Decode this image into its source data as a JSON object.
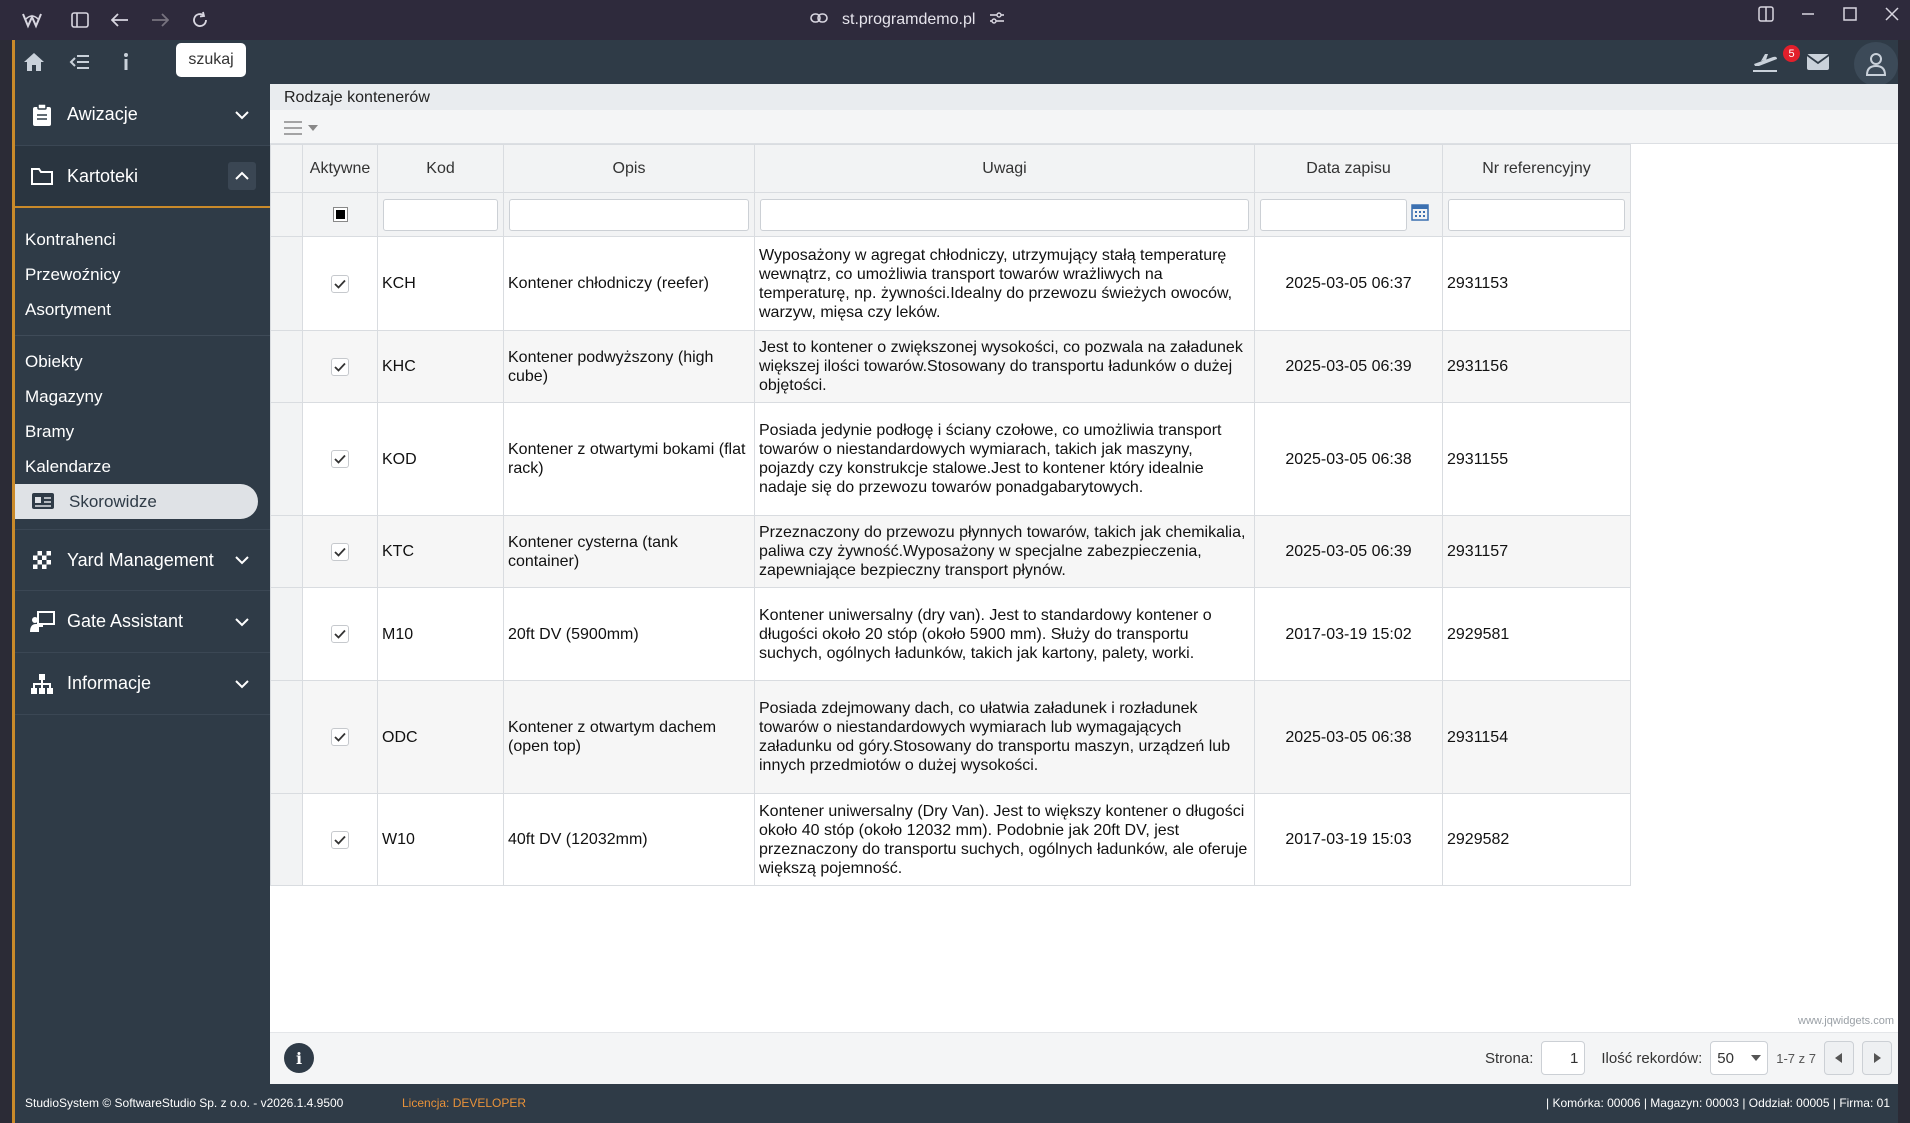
{
  "browser": {
    "url": "st.programdemo.pl"
  },
  "toolbar": {
    "search_label": "szukaj",
    "mail_count": "5"
  },
  "sidebar": {
    "sections": [
      {
        "label": "Awizacje"
      },
      {
        "label": "Kartoteki"
      },
      {
        "label": "Yard Management"
      },
      {
        "label": "Gate Assistant"
      },
      {
        "label": "Informacje"
      }
    ],
    "group1": [
      "Kontrahenci",
      "Przewoźnicy",
      "Asortyment"
    ],
    "group2": [
      "Obiekty",
      "Magazyny",
      "Bramy",
      "Kalendarze",
      "Skorowidze"
    ]
  },
  "panel": {
    "title": "Rodzaje kontenerów"
  },
  "grid": {
    "columns": [
      "Aktywne",
      "Kod",
      "Opis",
      "Uwagi",
      "Data zapisu",
      "Nr referencyjny"
    ],
    "rows": [
      {
        "code": "KCH",
        "desc": "Kontener chłodniczy (reefer)",
        "notes": "Wyposażony w agregat chłodniczy, utrzymujący stałą temperaturę wewnątrz, co umożliwia transport towarów wrażliwych na temperaturę, np. żywności.Idealny do przewozu świeżych owoców, warzyw, mięsa czy leków.",
        "date": "2025-03-05 06:37",
        "ref": "2931153"
      },
      {
        "code": "KHC",
        "desc": "Kontener podwyższony (high cube)",
        "notes": "Jest to kontener o zwiększonej wysokości, co pozwala na załadunek większej ilości towarów.Stosowany do transportu ładunków o dużej objętości.",
        "date": "2025-03-05 06:39",
        "ref": "2931156"
      },
      {
        "code": "KOD",
        "desc": "Kontener z otwartymi bokami (flat rack)",
        "notes": "Posiada jedynie podłogę i ściany czołowe, co umożliwia transport towarów o niestandardowych wymiarach, takich jak maszyny, pojazdy czy konstrukcje stalowe.Jest to kontener który idealnie nadaje się do przewozu towarów ponadgabarytowych.",
        "date": "2025-03-05 06:38",
        "ref": "2931155"
      },
      {
        "code": "KTC",
        "desc": "Kontener cysterna (tank container)",
        "notes": "Przeznaczony do przewozu płynnych towarów, takich jak chemikalia, paliwa czy żywność.Wyposażony w specjalne zabezpieczenia, zapewniające bezpieczny transport płynów.",
        "date": "2025-03-05 06:39",
        "ref": "2931157"
      },
      {
        "code": "M10",
        "desc": "20ft DV (5900mm)",
        "notes": "Kontener uniwersalny (dry van). Jest to standardowy kontener o długości około 20 stóp (około 5900 mm). Służy do transportu suchych, ogólnych ładunków, takich jak kartony, palety, worki.",
        "date": "2017-03-19 15:02",
        "ref": "2929581"
      },
      {
        "code": "ODC",
        "desc": "Kontener z otwartym dachem (open top)",
        "notes": "Posiada zdejmowany dach, co ułatwia załadunek i rozładunek towarów o niestandardowych wymiarach lub wymagających załadunku od góry.Stosowany do transportu maszyn, urządzeń lub innych przedmiotów o dużej wysokości.",
        "date": "2025-03-05 06:38",
        "ref": "2931154"
      },
      {
        "code": "W10",
        "desc": "40ft DV (12032mm)",
        "notes": "Kontener uniwersalny (Dry Van). Jest to większy kontener o długości około 40 stóp (około 12032 mm). Podobnie jak 20ft DV, jest przeznaczony do transportu suchych, ogólnych ładunków, ale oferuje większą pojemność.",
        "date": "2017-03-19 15:03",
        "ref": "2929582"
      }
    ]
  },
  "pager": {
    "page_label": "Strona:",
    "page_value": "1",
    "records_label": "Ilość rekordów:",
    "records_value": "50",
    "range": "1-7 z 7",
    "watermark": "www.jqwidgets.com"
  },
  "status": {
    "left": "StudioSystem © SoftwareStudio Sp. z o.o. - v2026.1.4.9500",
    "license": "Licencja: DEVELOPER",
    "right": "| Komórka: 00006 | Magazyn: 00003 | Oddział: 00005 | Firma: 01"
  },
  "colors": {
    "accent": "#c98a2a",
    "sidebar": "#2f3b47",
    "badge": "#e21f2b"
  }
}
